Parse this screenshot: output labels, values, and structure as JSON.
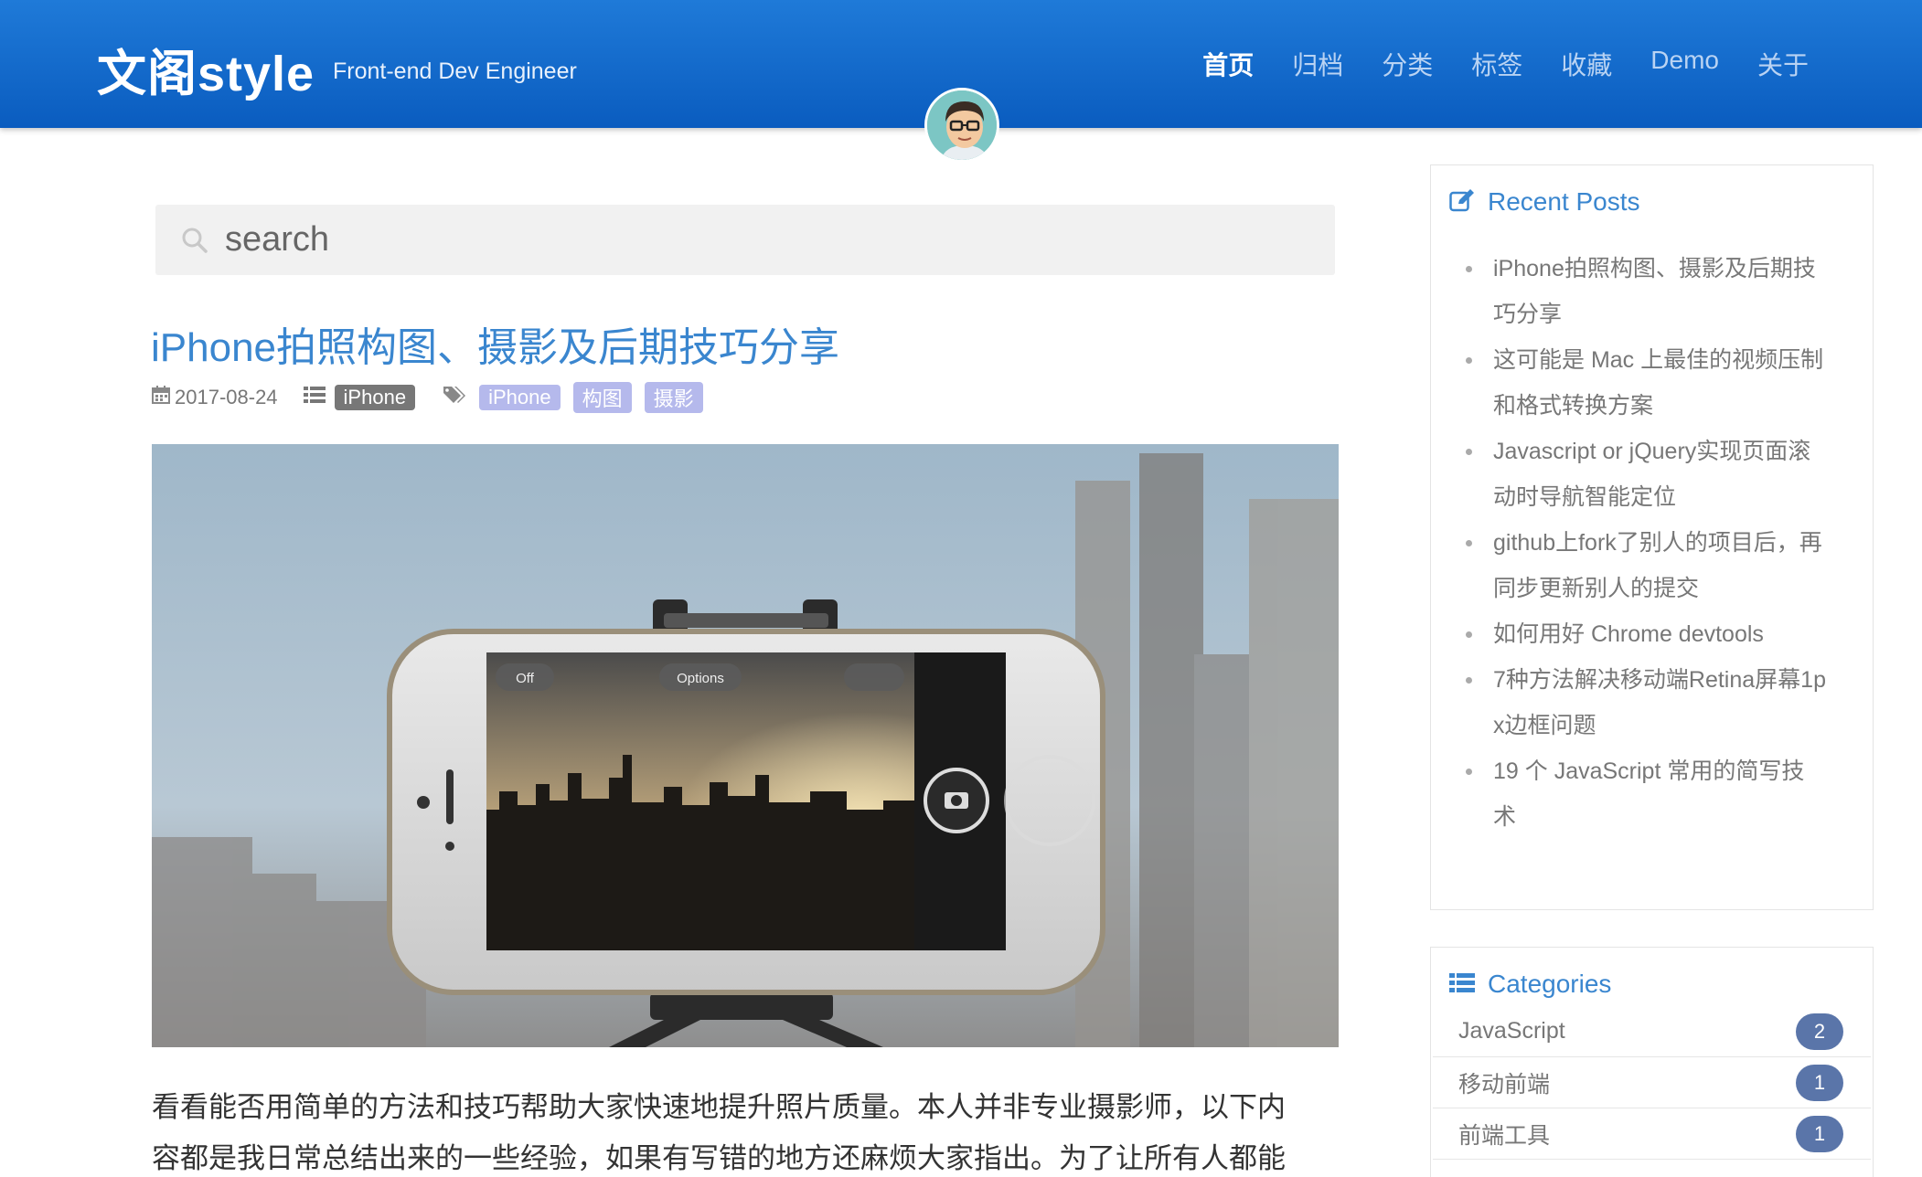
{
  "header": {
    "brand": "文阁style",
    "tagline": "Front-end Dev Engineer",
    "nav": [
      {
        "label": "首页",
        "active": true
      },
      {
        "label": "归档"
      },
      {
        "label": "分类"
      },
      {
        "label": "标签"
      },
      {
        "label": "收藏"
      },
      {
        "label": "Demo"
      },
      {
        "label": "关于"
      }
    ]
  },
  "search": {
    "placeholder": "search"
  },
  "post": {
    "title": "iPhone拍照构图、摄影及后期技巧分享",
    "date": "2017-08-24",
    "category": "iPhone",
    "tags": [
      "iPhone",
      "构图",
      "摄影"
    ],
    "excerpt_line1": "看看能否用简单的方法和技巧帮助大家快速地提升照片质量。本人并非专业摄影师，以下内",
    "excerpt_line2": "容都是我日常总结出来的一些经验，如果有写错的地方还麻烦大家指出。为了让所有人都能"
  },
  "hero_image": {
    "screen_labels": {
      "flash": "Off",
      "options": "Options"
    }
  },
  "sidebar": {
    "recent_title": "Recent Posts",
    "recent_posts": [
      {
        "l1": "iPhone拍照构图、摄影及后期技",
        "l2": "巧分享"
      },
      {
        "l1": "这可能是 Mac 上最佳的视频压制",
        "l2": "和格式转换方案"
      },
      {
        "l1": "Javascript or jQuery实现页面滚",
        "l2": "动时导航智能定位"
      },
      {
        "l1": "github上fork了别人的项目后，再",
        "l2": "同步更新别人的提交"
      },
      {
        "l1": "如何用好 Chrome devtools",
        "l2": ""
      },
      {
        "l1": "7种方法解决移动端Retina屏幕1p",
        "l2": "x边框问题"
      },
      {
        "l1": "19 个 JavaScript 常用的简写技",
        "l2": "术"
      }
    ],
    "categories_title": "Categories",
    "categories": [
      {
        "name": "JavaScript",
        "count": "2"
      },
      {
        "name": "移动前端",
        "count": "1"
      },
      {
        "name": "前端工具",
        "count": "1"
      }
    ]
  },
  "colors": {
    "header": "#0a5cbf",
    "link": "#3a86cf",
    "tag": "#b5b9ec",
    "category_badge": "#777777",
    "count_badge": "#5a75a9"
  },
  "icons": [
    "search-icon",
    "calendar-icon",
    "list-icon",
    "tags-icon",
    "edit-icon",
    "avatar"
  ]
}
